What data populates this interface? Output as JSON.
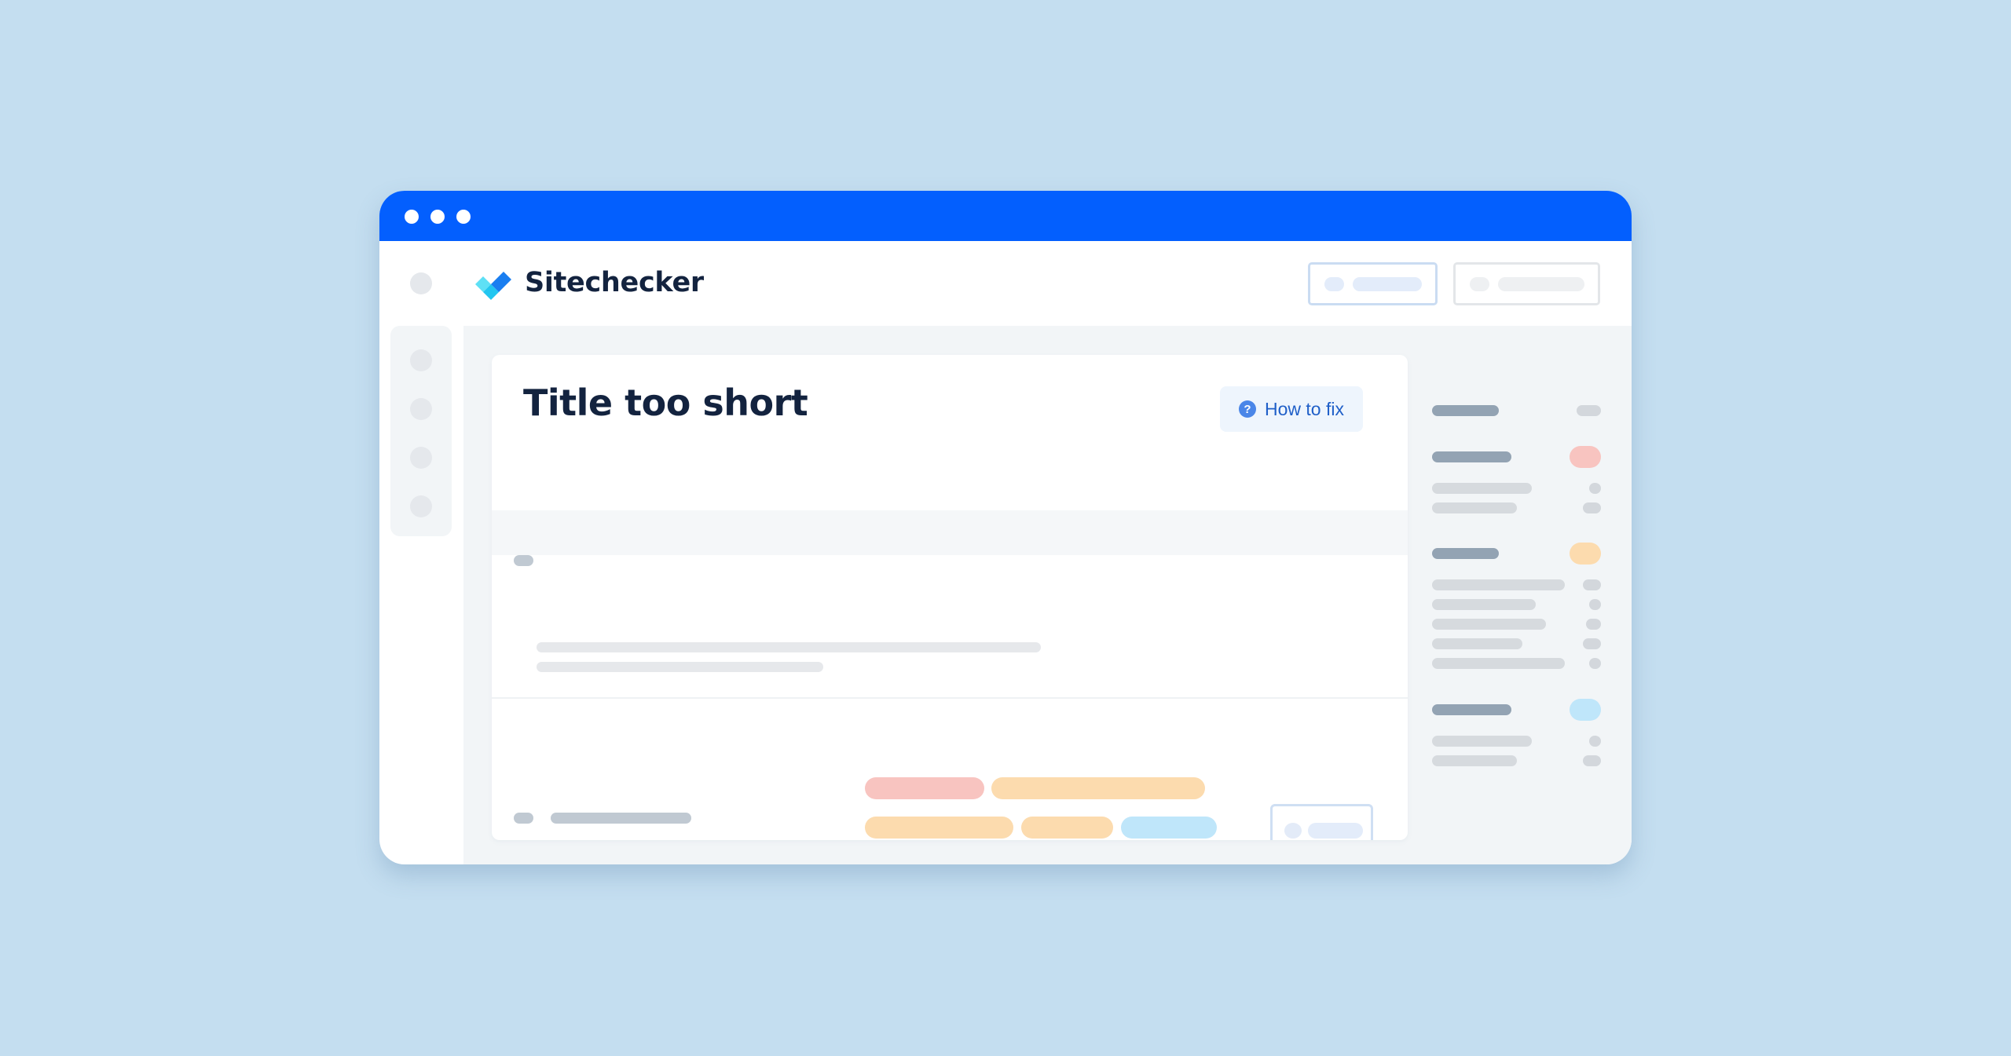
{
  "window": {
    "titlebar_color": "#035ffe",
    "controls": [
      "dot",
      "dot",
      "dot"
    ]
  },
  "header": {
    "brand_name": "Sitechecker",
    "logo_icon": "checkmark-logo-icon",
    "buttons": [
      {
        "name": "header-button-primary",
        "style": "blue-outline"
      },
      {
        "name": "header-button-secondary",
        "style": "gray-outline"
      }
    ]
  },
  "sidebar": {
    "items": [
      "nav-item",
      "nav-item",
      "nav-item",
      "nav-item"
    ]
  },
  "issue_card": {
    "title": "Title too short",
    "how_to_fix": {
      "label": "How to fix",
      "icon": "question-circle-icon",
      "icon_glyph": "?"
    },
    "rows": [
      {
        "tags": [
          {
            "color": "red"
          },
          {
            "color": "orange"
          },
          {
            "color": "orange"
          },
          {
            "color": "orange"
          },
          {
            "color": "blue"
          },
          {
            "color": "blue"
          }
        ]
      },
      {
        "tags": [
          {
            "color": "red"
          },
          {
            "color": "red"
          },
          {
            "color": "orange"
          },
          {
            "color": "orange"
          }
        ]
      }
    ]
  },
  "right_panel": {
    "sections": [
      {
        "badge": "none",
        "lines": 0
      },
      {
        "badge": "red",
        "lines": 2
      },
      {
        "badge": "orange",
        "lines": 5
      },
      {
        "badge": "blue",
        "lines": 2
      }
    ]
  },
  "colors": {
    "background": "#c4def0",
    "accent": "#035ffe",
    "tag_red": "#f8c4c0",
    "tag_orange": "#fcdbae",
    "tag_blue": "#bfe6fa",
    "link": "#1f5fc8"
  }
}
